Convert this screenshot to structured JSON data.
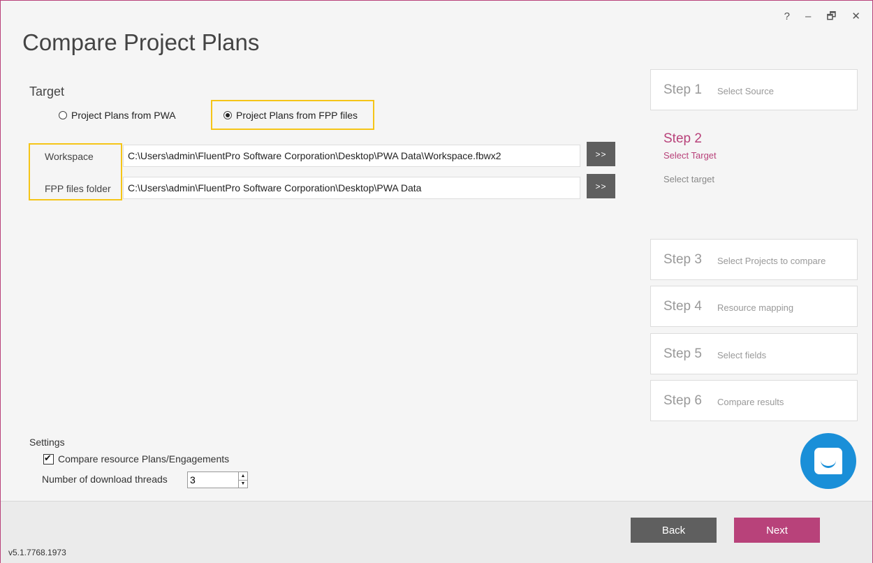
{
  "window": {
    "title": "Compare Project Plans",
    "help": "?",
    "minimize": "–",
    "restore": "🗗",
    "close": "✕"
  },
  "target": {
    "label": "Target",
    "options": [
      "Project Plans from PWA",
      "Project Plans from FPP files"
    ],
    "selected": "Project Plans from FPP files"
  },
  "fields": {
    "workspace": {
      "label": "Workspace",
      "value": "C:\\Users\\admin\\FluentPro Software Corporation\\Desktop\\PWA Data\\Workspace.fbwx2",
      "browse": ">>"
    },
    "fpp_folder": {
      "label": "FPP files folder",
      "value": "C:\\Users\\admin\\FluentPro Software Corporation\\Desktop\\PWA Data",
      "browse": ">>"
    }
  },
  "steps": [
    {
      "num": "Step 1",
      "desc": "Select Source"
    },
    {
      "num": "Step 2",
      "desc": "Select Target",
      "sub": "Select target",
      "active": true
    },
    {
      "num": "Step 3",
      "desc": "Select Projects to compare"
    },
    {
      "num": "Step 4",
      "desc": "Resource mapping"
    },
    {
      "num": "Step 5",
      "desc": "Select fields"
    },
    {
      "num": "Step 6",
      "desc": "Compare results"
    }
  ],
  "settings": {
    "label": "Settings",
    "compare_resources": {
      "label": "Compare resource Plans/Engagements",
      "checked": true
    },
    "threads": {
      "label": "Number of download threads",
      "value": "3"
    }
  },
  "footer": {
    "back": "Back",
    "next": "Next",
    "version": "v5.1.7768.1973"
  },
  "colors": {
    "accent": "#b8427a",
    "highlight": "#f5c518",
    "dark_button": "#5f5f5f",
    "chat": "#1a8fd8"
  },
  "icons": {
    "chat": "chat-bubble-icon"
  }
}
